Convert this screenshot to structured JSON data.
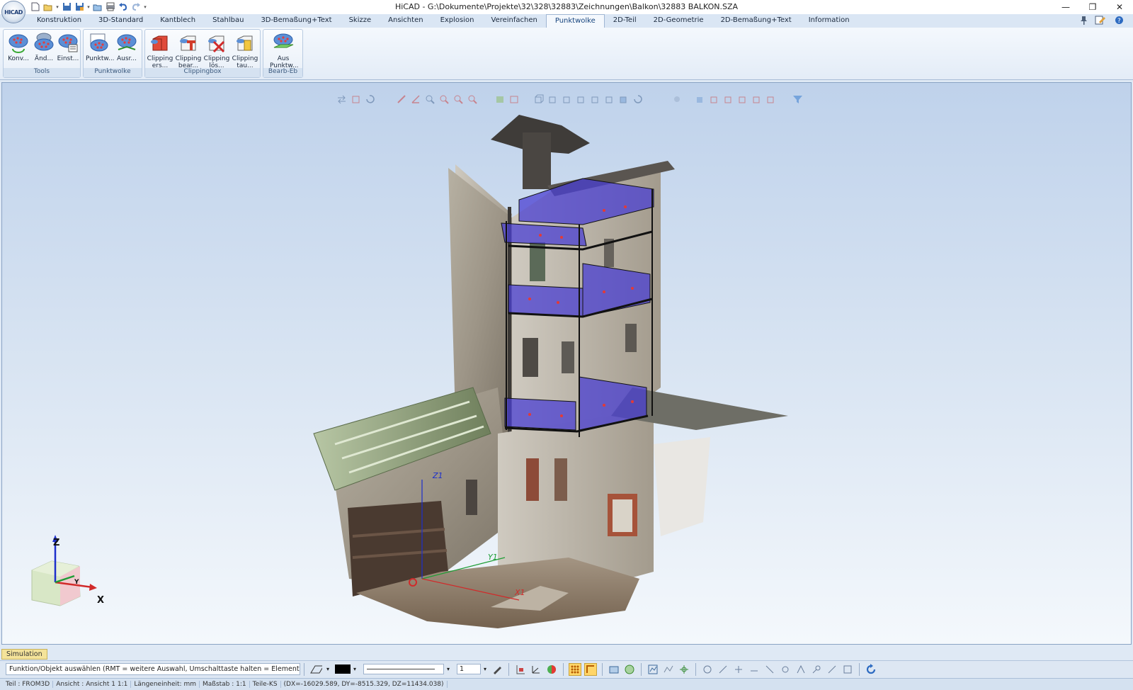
{
  "window": {
    "title": "HiCAD - G:\\Dokumente\\Projekte\\32\\328\\32883\\Zeichnungen\\Balkon\\32883 BALKON.SZA",
    "logo_text": "HICAD"
  },
  "ribbon": {
    "tabs": [
      "Konstruktion",
      "3D-Standard",
      "Kantblech",
      "Stahlbau",
      "3D-Bemaßung+Text",
      "Skizze",
      "Ansichten",
      "Explosion",
      "Vereinfachen",
      "Punktwolke",
      "2D-Teil",
      "2D-Geometrie",
      "2D-Bemaßung+Text",
      "Information"
    ],
    "active_tab": "Punktwolke",
    "groups": [
      {
        "label": "Tools",
        "buttons": [
          "Konv...",
          "Änd...",
          "Einst..."
        ]
      },
      {
        "label": "Punktwolke",
        "buttons": [
          "Punktw...",
          "Ausr..."
        ]
      },
      {
        "label": "Clippingbox",
        "buttons": [
          "Clipping\ners...",
          "Clipping\nbear...",
          "Clipping\nlös...",
          "Clipping\ntau..."
        ]
      },
      {
        "label": "Bearb-Eb",
        "buttons": [
          "Aus\nPunktw..."
        ]
      }
    ]
  },
  "viewport": {
    "axis_labels": {
      "x": "X",
      "y": "Y",
      "z": "Z"
    },
    "scene_labels": {
      "x1": "X1",
      "y1": "Y1",
      "z1": "Z1"
    }
  },
  "bottom": {
    "simulation_tab": "Simulation",
    "prompt": "Funktion/Objekt auswählen (RMT = weitere Auswahl, Umschalttaste halten = Elementfang)",
    "line_width": "1",
    "color": "#000000"
  },
  "statusbar": {
    "items": [
      "Teil : FROM3D",
      "Ansicht : Ansicht 1 1:1",
      "Längeneinheit: mm",
      "Maßstab : 1:1",
      "Teile-KS",
      "(DX=-16029.589, DY=-8515.329, DZ=11434.038)"
    ]
  }
}
